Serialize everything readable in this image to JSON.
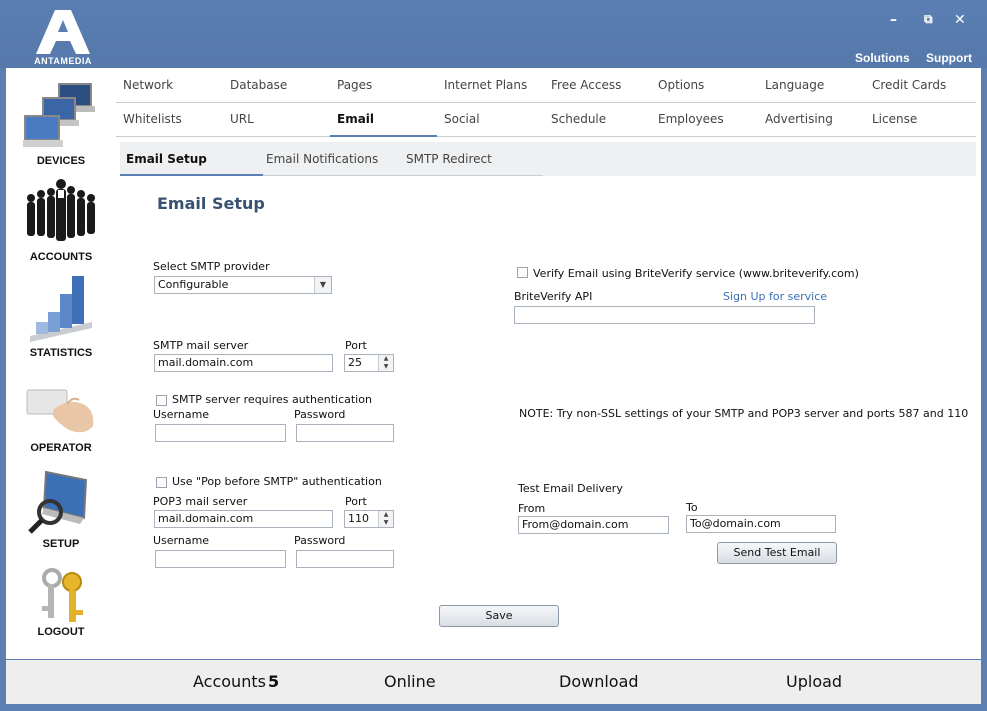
{
  "app": {
    "logo_text": "ANTAMEDIA",
    "window_controls": {
      "minimize": "–",
      "restore": "⧉",
      "close": "✕"
    },
    "top_links": {
      "solutions": "Solutions",
      "support": "Support"
    }
  },
  "sidebar": {
    "items": [
      {
        "label": "DEVICES",
        "icon": "devices-icon"
      },
      {
        "label": "ACCOUNTS",
        "icon": "accounts-icon"
      },
      {
        "label": "STATISTICS",
        "icon": "statistics-icon"
      },
      {
        "label": "OPERATOR",
        "icon": "operator-icon"
      },
      {
        "label": "SETUP",
        "icon": "setup-icon"
      },
      {
        "label": "LOGOUT",
        "icon": "logout-icon"
      }
    ]
  },
  "tabs": {
    "row1": [
      "Network",
      "Database",
      "Pages",
      "Internet Plans",
      "Free Access",
      "Options",
      "Language",
      "Credit Cards"
    ],
    "row2": [
      "Whitelists",
      "URL",
      "Email",
      "Social",
      "Schedule",
      "Employees",
      "Advertising",
      "License"
    ],
    "active": "Email"
  },
  "subtabs": {
    "items": [
      "Email Setup",
      "Email Notifications",
      "SMTP Redirect"
    ],
    "active": "Email Setup"
  },
  "email_setup": {
    "heading": "Email Setup",
    "smtp_provider_label": "Select SMTP provider",
    "smtp_provider_value": "Configurable",
    "smtp_server_label": "SMTP mail server",
    "smtp_server_value": "mail.domain.com",
    "smtp_port_label": "Port",
    "smtp_port_value": "25",
    "smtp_auth_label": "SMTP server requires authentication",
    "smtp_auth_checked": false,
    "username_label": "Username",
    "password_label": "Password",
    "username_value": "",
    "password_value": "",
    "pop_auth_label": "Use \"Pop before SMTP\" authentication",
    "pop_auth_checked": false,
    "pop3_server_label": "POP3 mail server",
    "pop3_server_value": "mail.domain.com",
    "pop3_port_label": "Port",
    "pop3_port_value": "110",
    "pop_username_label": "Username",
    "pop_password_label": "Password",
    "pop_username_value": "",
    "pop_password_value": "",
    "briteverify_label": "Verify Email using BriteVerify service (www.briteverify.com)",
    "briteverify_checked": false,
    "briteverify_api_label": "BriteVerify API",
    "briteverify_signup_link": "Sign Up for service",
    "briteverify_api_value": "",
    "note": "NOTE:  Try non-SSL settings of your SMTP and POP3 server and ports 587 and 110",
    "test_heading": "Test Email Delivery",
    "from_label": "From",
    "from_value": "From@domain.com",
    "to_label": "To",
    "to_value": "To@domain.com",
    "send_test_button": "Send Test Email",
    "save_button": "Save"
  },
  "statusbar": {
    "accounts_label": "Accounts",
    "accounts_count": "5",
    "online_label": "Online",
    "download_label": "Download",
    "upload_label": "Upload"
  }
}
